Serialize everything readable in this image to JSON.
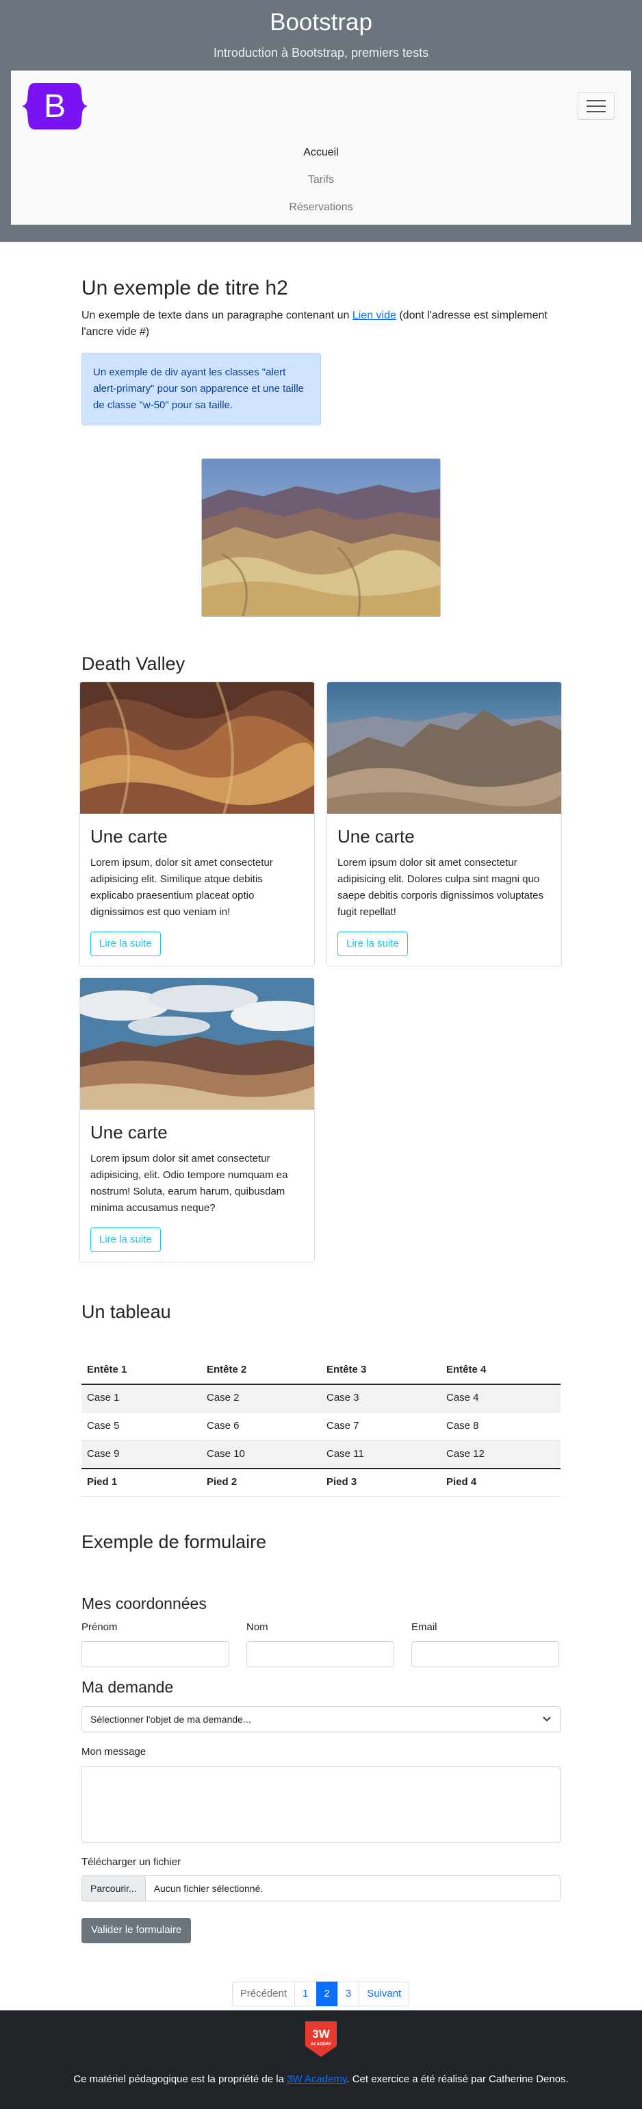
{
  "header": {
    "title": "Bootstrap",
    "subtitle": "Introduction à Bootstrap, premiers tests",
    "brand_letter": "B"
  },
  "nav": {
    "items": [
      "Accueil",
      "Tarifs",
      "Réservations"
    ]
  },
  "intro": {
    "h2": "Un exemple de titre h2",
    "text_before": "Un exemple de texte dans un paragraphe contenant un ",
    "link": "Lien vide",
    "text_after": " (dont l'adresse est simplement l'ancre vide #)",
    "alert": "Un exemple de div ayant les classes \"alert alert-primary\" pour son apparence et une taille de classe \"w-50\" pour sa taille."
  },
  "death_valley": {
    "title": "Death Valley",
    "cards": [
      {
        "title": "Une carte",
        "text": "Lorem ipsum, dolor sit amet consectetur adipisicing elit. Similique atque debitis explicabo praesentium placeat optio dignissimos est quo veniam in!",
        "button": "Lire la suite"
      },
      {
        "title": "Une carte",
        "text": "Lorem ipsum dolor sit amet consectetur adipisicing elit. Dolores culpa sint magni quo saepe debitis corporis dignissimos voluptates fugit repellat!",
        "button": "Lire la suite"
      },
      {
        "title": "Une carte",
        "text": "Lorem ipsum dolor sit amet consectetur adipisicing, elit. Odio tempore numquam ea nostrum! Soluta, earum harum, quibusdam minima accusamus neque?",
        "button": "Lire la suite"
      }
    ]
  },
  "table": {
    "title": "Un tableau",
    "headers": [
      "Entête 1",
      "Entête 2",
      "Entête 3",
      "Entête 4"
    ],
    "rows": [
      [
        "Case 1",
        "Case 2",
        "Case 3",
        "Case 4"
      ],
      [
        "Case 5",
        "Case 6",
        "Case 7",
        "Case 8"
      ],
      [
        "Case 9",
        "Case 10",
        "Case 11",
        "Case 12"
      ]
    ],
    "footer": [
      "Pied 1",
      "Pied 2",
      "Pied 3",
      "Pied 4"
    ]
  },
  "form": {
    "title": "Exemple de formulaire",
    "coords_title": "Mes coordonnées",
    "prenom_label": "Prénom",
    "nom_label": "Nom",
    "email_label": "Email",
    "demande_title": "Ma demande",
    "select_value": "Sélectionner l'objet de ma demande...",
    "message_label": "Mon message",
    "file_label": "Télécharger un fichier",
    "file_button": "Parcourir...",
    "file_name": "Aucun fichier sélectionné.",
    "submit": "Valider le formulaire"
  },
  "pagination": {
    "prev": "Précédent",
    "pages": [
      "1",
      "2",
      "3"
    ],
    "active": "2",
    "next": "Suivant"
  },
  "footer": {
    "logo_text_top": "3W",
    "logo_text_bottom": "ACADEMY",
    "text_before": "Ce matériel pédagogique est la propriété de la ",
    "link": "3W Academy",
    "text_after": ". Cet exercice a été réalisé par Catherine Denos."
  },
  "colors": {
    "header_bg": "#6c757d",
    "brand_purple": "#7a13f2",
    "primary": "#0d6efd",
    "info": "#0dcaf0",
    "footer_bg": "#212529",
    "logo_red": "#e63a2f"
  }
}
